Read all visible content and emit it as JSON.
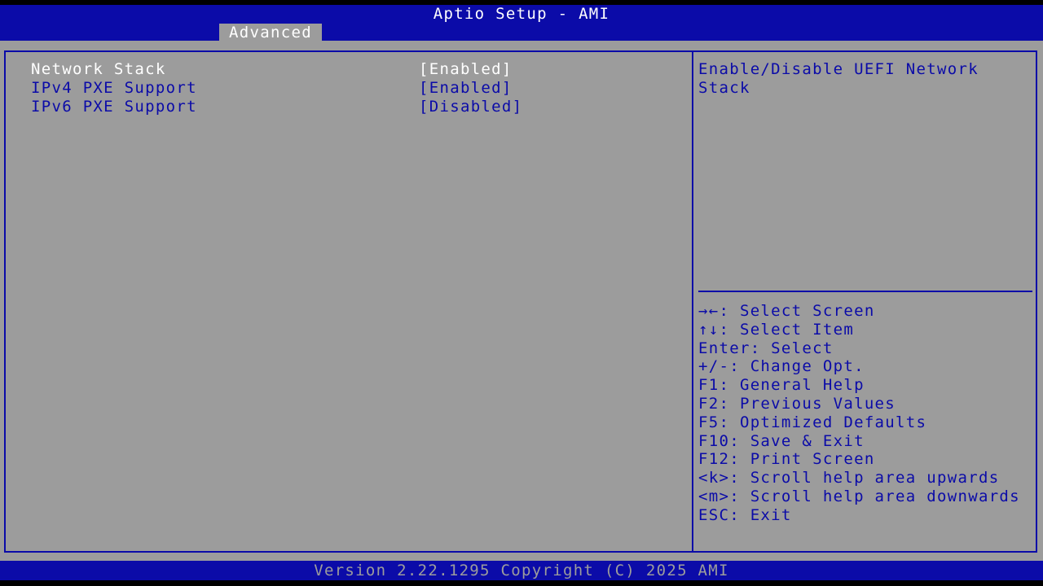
{
  "header": {
    "title": "Aptio Setup - AMI",
    "tabs": [
      {
        "label": "Advanced",
        "active": true
      }
    ]
  },
  "settings": [
    {
      "label": "Network Stack",
      "value": "[Enabled]",
      "selected": true
    },
    {
      "label": "IPv4 PXE Support",
      "value": "[Enabled]",
      "selected": false
    },
    {
      "label": "IPv6 PXE Support",
      "value": "[Disabled]",
      "selected": false
    }
  ],
  "help": {
    "description": "Enable/Disable UEFI Network Stack"
  },
  "keys": [
    "→←: Select Screen",
    "↑↓: Select Item",
    "Enter: Select",
    "+/-: Change Opt.",
    "F1: General Help",
    "F2: Previous Values",
    "F5: Optimized Defaults",
    "F10: Save & Exit",
    "F12: Print Screen",
    "<k>: Scroll help area upwards",
    "<m>: Scroll help area downwards",
    "ESC: Exit"
  ],
  "footer": {
    "text": "Version 2.22.1295 Copyright (C) 2025 AMI"
  },
  "colors": {
    "frame_blue": "#0b0ba8",
    "panel_gray": "#9c9c9c",
    "selected_text": "#ffffff"
  }
}
